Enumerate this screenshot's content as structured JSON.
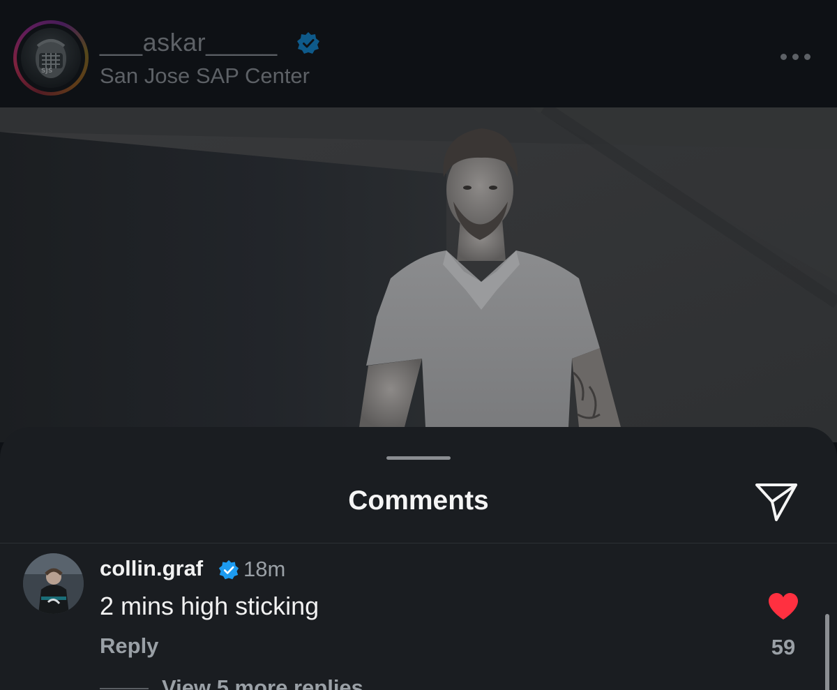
{
  "post": {
    "username": "___askar_____",
    "location": "San Jose SAP Center",
    "verified_icon": "verified-badge-icon",
    "more_icon": "more-horizontal-icon"
  },
  "comments_sheet": {
    "title": "Comments",
    "share_icon": "send-icon",
    "comments": [
      {
        "username": "collin.graf",
        "time": "18m",
        "text": "2 mins high sticking",
        "reply_label": "Reply",
        "like_count": "59",
        "liked": true,
        "view_replies": "View 5 more replies"
      }
    ]
  },
  "colors": {
    "accent_verified": "#1d9bf0",
    "like_red": "#ff3040",
    "background": "#0e1115",
    "sheet": "#1a1d21"
  }
}
